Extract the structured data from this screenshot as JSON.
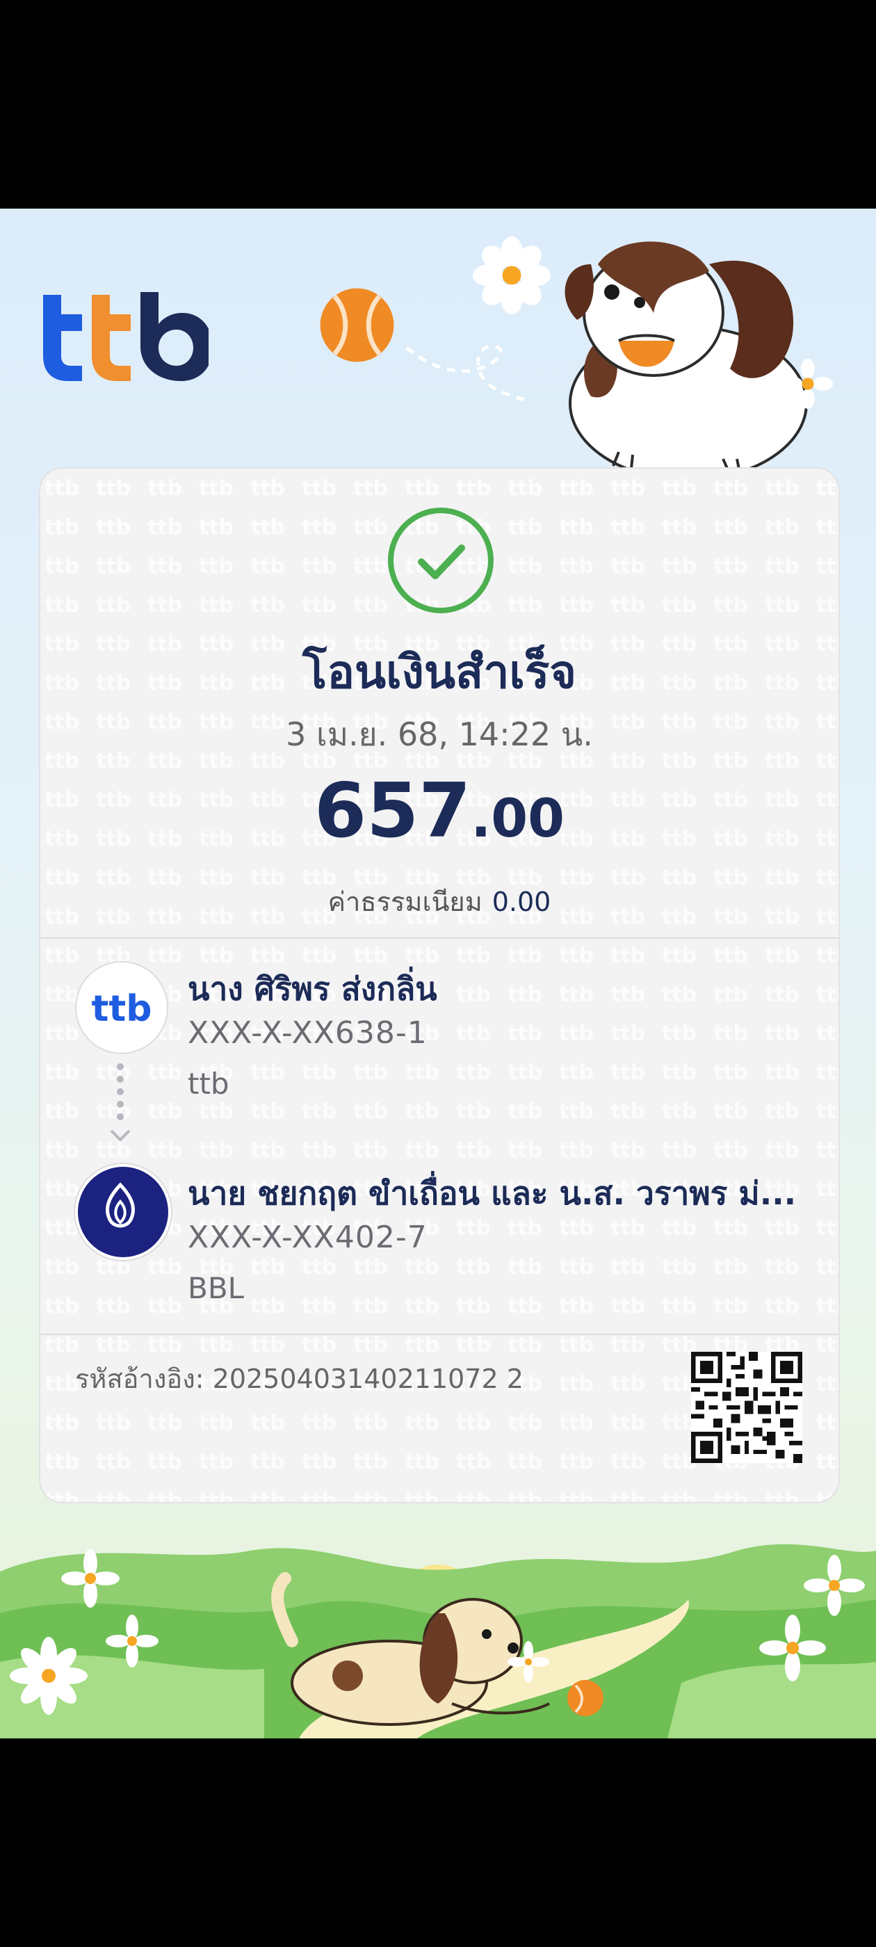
{
  "brand": {
    "logo_text": "ttb"
  },
  "status": {
    "title": "โอนเงินสำเร็จ",
    "datetime": "3 เม.ย. 68, 14:22 น."
  },
  "amount": {
    "integer": "657",
    "decimal": ".00"
  },
  "fee": {
    "label": "ค่าธรรมเนียม",
    "value": "0.00"
  },
  "sender": {
    "name": "นาง ศิริพร ส่งกลิ่น",
    "account": "XXX-X-XX638-1",
    "bank": "ttb",
    "logo_text": "ttb"
  },
  "receiver": {
    "name": "นาย ชยกฤต ขำเถื่อน และ น.ส. วราพร ม่...",
    "account": "XXX-X-XX402-7",
    "bank": "BBL"
  },
  "reference": {
    "label": "รหัสอ้างอิง:",
    "value": "20250403140211072 2"
  },
  "colors": {
    "navy": "#1c2b57",
    "success": "#4caf50",
    "ttb_blue": "#1e5ce0",
    "ttb_orange": "#f08a24",
    "bbl": "#1c2280"
  },
  "icons": [
    "ttb-logo",
    "check-circle-icon",
    "arrow-down-icon",
    "bbl-logo-icon",
    "qr-code",
    "tennis-ball",
    "dog-illustration",
    "flower-icon"
  ]
}
